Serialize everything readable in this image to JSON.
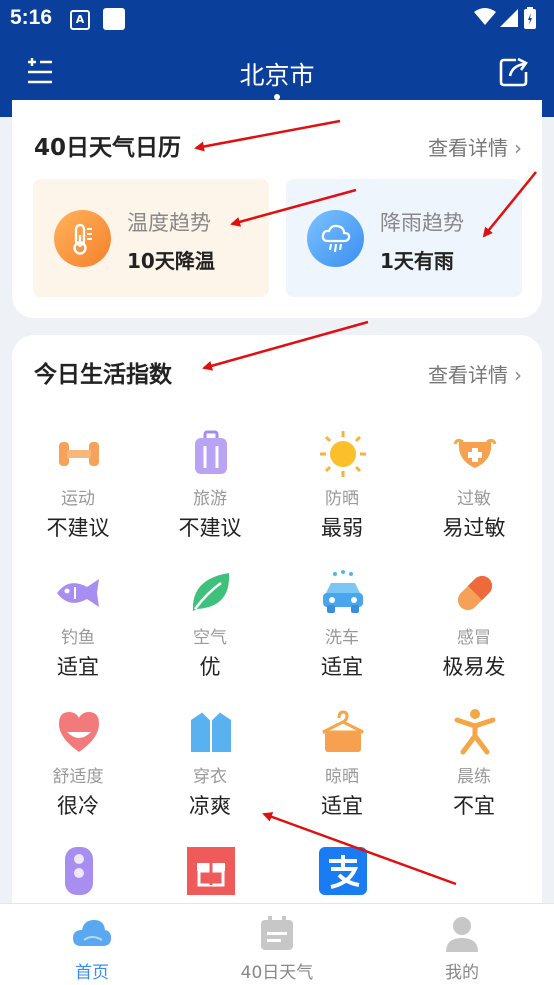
{
  "status_bar": {
    "time": "5:16",
    "a_glyph": "A"
  },
  "header": {
    "title": "北京市"
  },
  "calendar": {
    "title": "40日天气日历",
    "link": "查看详情",
    "temp": {
      "label": "温度趋势",
      "value": "10天降温",
      "icon": "thermometer-icon"
    },
    "rain": {
      "label": "降雨趋势",
      "value": "1天有雨",
      "icon": "rain-cloud-icon"
    }
  },
  "life": {
    "title": "今日生活指数",
    "link": "查看详情",
    "items": [
      {
        "label": "运动",
        "value": "不建议",
        "icon": "dumbbell-icon"
      },
      {
        "label": "旅游",
        "value": "不建议",
        "icon": "suitcase-icon"
      },
      {
        "label": "防晒",
        "value": "最弱",
        "icon": "sun-icon"
      },
      {
        "label": "过敏",
        "value": "易过敏",
        "icon": "mask-icon"
      },
      {
        "label": "钓鱼",
        "value": "适宜",
        "icon": "fish-icon"
      },
      {
        "label": "空气",
        "value": "优",
        "icon": "leaf-icon"
      },
      {
        "label": "洗车",
        "value": "适宜",
        "icon": "car-icon"
      },
      {
        "label": "感冒",
        "value": "极易发",
        "icon": "pill-icon"
      },
      {
        "label": "舒适度",
        "value": "很冷",
        "icon": "heart-icon"
      },
      {
        "label": "穿衣",
        "value": "凉爽",
        "icon": "shirt-icon"
      },
      {
        "label": "晾晒",
        "value": "适宜",
        "icon": "hanger-icon"
      },
      {
        "label": "晨练",
        "value": "不宜",
        "icon": "exercise-icon"
      }
    ],
    "partial_icons": [
      "traffic-light-icon",
      "gift-icon",
      "alipay-icon"
    ]
  },
  "bottom_nav": [
    {
      "label": "首页",
      "icon": "cloud-home-icon",
      "active": true
    },
    {
      "label": "40日天气",
      "icon": "calendar-icon",
      "active": false
    },
    {
      "label": "我的",
      "icon": "user-icon",
      "active": false
    }
  ],
  "colors": {
    "header_bg": "#0a3f9c",
    "accent": "#3a8ef0",
    "annotation": "#e01010"
  }
}
